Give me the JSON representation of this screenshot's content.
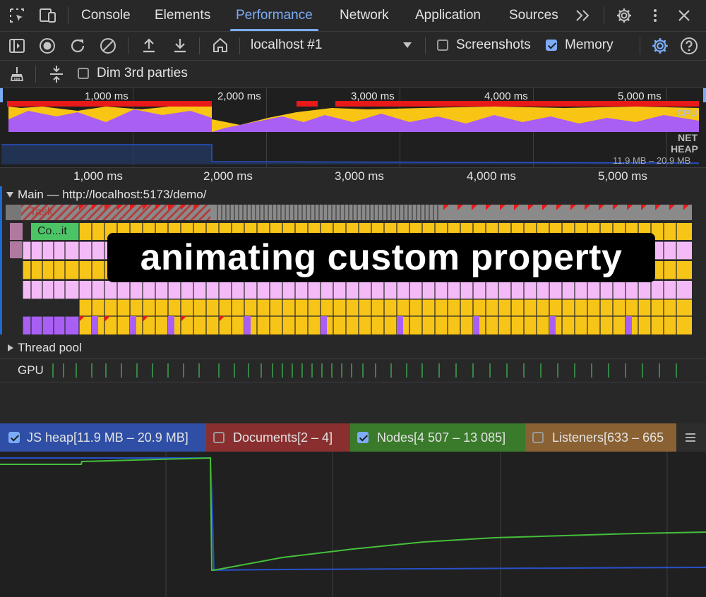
{
  "tabs": [
    {
      "label": "Console",
      "active": false
    },
    {
      "label": "Elements",
      "active": false
    },
    {
      "label": "Performance",
      "active": true
    },
    {
      "label": "Network",
      "active": false
    },
    {
      "label": "Application",
      "active": false
    },
    {
      "label": "Sources",
      "active": false
    }
  ],
  "toolbar": {
    "target": "localhost #1",
    "screenshots_label": "Screenshots",
    "screenshots_checked": false,
    "memory_label": "Memory",
    "memory_checked": true
  },
  "toolbar2": {
    "dim_label": "Dim 3rd parties",
    "dim_checked": false
  },
  "overview": {
    "ticks": [
      "1,000 ms",
      "2,000 ms",
      "3,000 ms",
      "4,000 ms",
      "5,000 ms"
    ],
    "cpu_label": "CPU",
    "net_label": "NET",
    "heap_label": "HEAP",
    "heap_range": "11.9 MB – 20.9 MB"
  },
  "ruler": {
    "ticks": [
      "1,000 ms",
      "2,000 ms",
      "3,000 ms",
      "4,000 ms",
      "5,000 ms"
    ]
  },
  "tracks": {
    "main_label": "Main — http://localhost:5173/demo/",
    "task_label": "Task",
    "commit_label": "Co...it",
    "thread_pool_label": "Thread pool",
    "gpu_label": "GPU"
  },
  "overlay_text": "animating custom property",
  "memory_legend": [
    {
      "label": "JS heap[11.9 MB – 20.9 MB]",
      "checked": true,
      "color": "#2f4fa6"
    },
    {
      "label": "Documents[2 – 4]",
      "checked": false,
      "color": "#8a2f2f"
    },
    {
      "label": "Nodes[4 507 – 13 085]",
      "checked": true,
      "color": "#3a7a2b"
    },
    {
      "label": "Listeners[633 – 665",
      "checked": false,
      "color": "#8a6132"
    }
  ],
  "colors": {
    "accent": "#7cacf8",
    "cpu_scripting": "#f9c514",
    "cpu_rendering": "#a95ff4",
    "task_red": "#e81919",
    "flame_pink": "#f4b9f7",
    "flame_yellow": "#f7c418",
    "commit_green": "#4cc466",
    "heap_line": "#2850c8",
    "nodes_line": "#44c03a"
  }
}
